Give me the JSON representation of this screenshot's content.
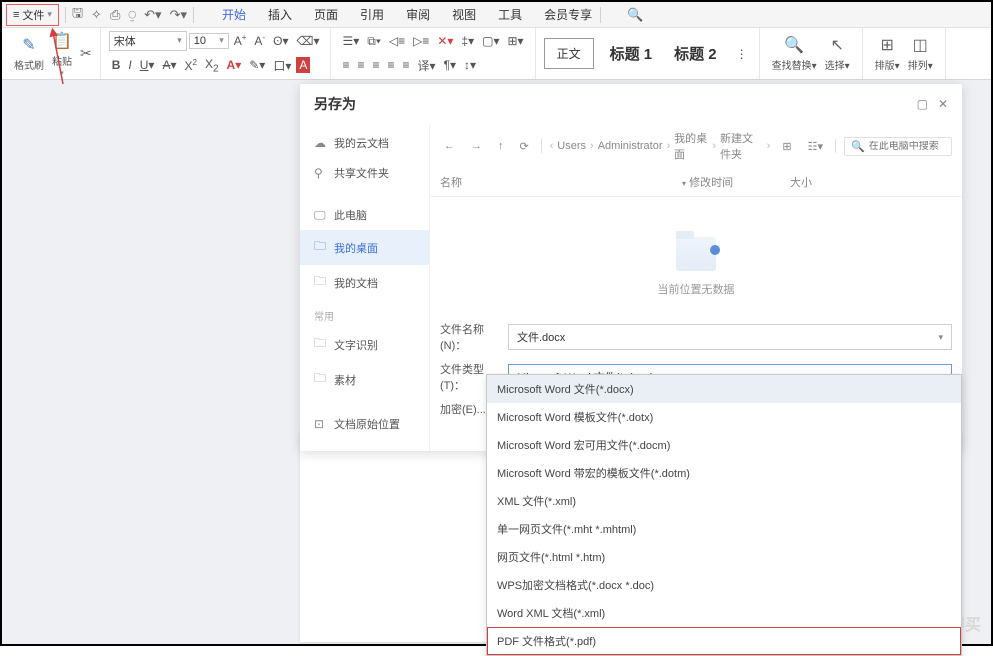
{
  "topbar": {
    "file_label": "文件",
    "tabs": [
      "开始",
      "插入",
      "页面",
      "引用",
      "审阅",
      "视图",
      "工具",
      "会员专享"
    ],
    "active_tab": 0
  },
  "ribbon": {
    "format_painter": "格式刷",
    "paste": "粘贴",
    "font_name": "宋体",
    "font_size": "10",
    "body_style": "正文",
    "heading1": "标题 1",
    "heading2": "标题 2",
    "find_replace": "查找替换",
    "select": "选择",
    "layout": "排版",
    "arrange": "排列"
  },
  "dialog": {
    "title": "另存为",
    "sidebar": {
      "cloud": "我的云文档",
      "shared": "共享文件夹",
      "computer": "此电脑",
      "desktop": "我的桌面",
      "documents": "我的文档",
      "common_label": "常用",
      "ocr": "文字识别",
      "material": "素材",
      "original": "文档原始位置"
    },
    "breadcrumb": [
      "Users",
      "Administrator",
      "我的桌面",
      "新建文件夹"
    ],
    "search_placeholder": "在此电脑中搜索",
    "list_headers": {
      "name": "名称",
      "modified": "修改时间",
      "size": "大小"
    },
    "empty_message": "当前位置无数据",
    "form": {
      "filename_label": "文件名称(N)：",
      "filename_value": "文件.docx",
      "filetype_label": "文件类型(T)：",
      "filetype_value": "Microsoft Word 文件(*.docx)",
      "encrypt_label": "加密(E)..."
    },
    "dropdown_options": [
      "Microsoft Word 文件(*.docx)",
      "Microsoft Word 模板文件(*.dotx)",
      "Microsoft Word 宏可用文件(*.docm)",
      "Microsoft Word 带宏的模板文件(*.dotm)",
      "XML 文件(*.xml)",
      "单一网页文件(*.mht *.mhtml)",
      "网页文件(*.html *.htm)",
      "WPS加密文档格式(*.docx *.doc)",
      "Word XML 文档(*.xml)",
      "PDF 文件格式(*.pdf)"
    ]
  },
  "watermark": "什么值得买"
}
